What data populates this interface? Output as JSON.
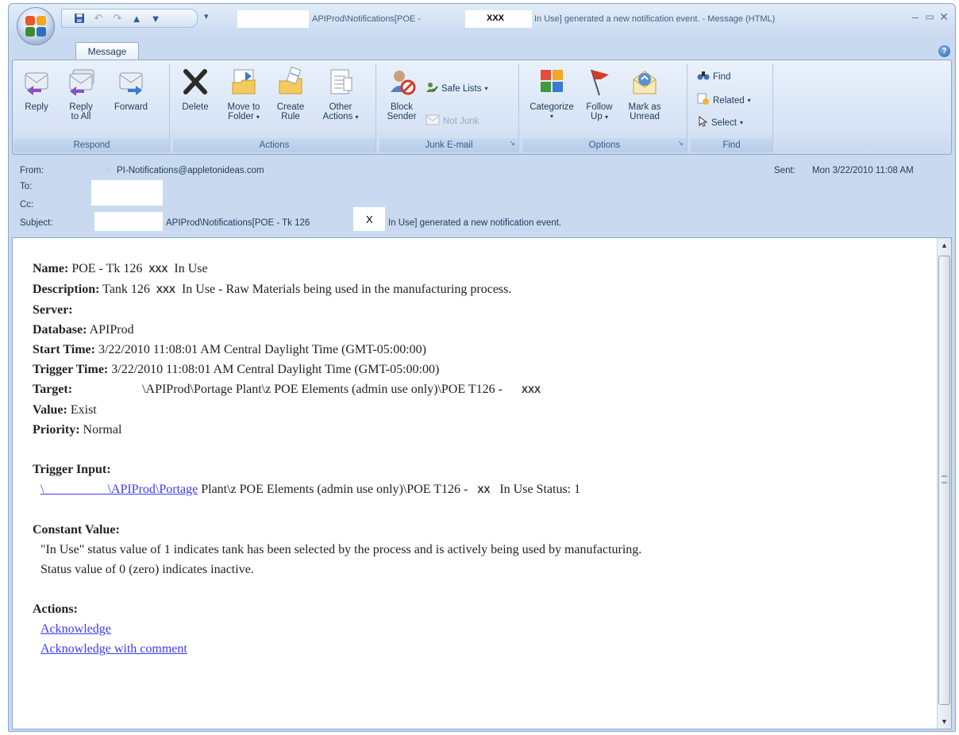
{
  "window": {
    "title_pre": "APIProd\\Notifications[POE -",
    "title_xxx": "XXX",
    "title_post": "In Use] generated a new notification event. - Message (HTML)"
  },
  "tabs": {
    "message": "Message"
  },
  "ribbon": {
    "respond": {
      "label": "Respond",
      "reply": "Reply",
      "reply_all_1": "Reply",
      "reply_all_2": "to All",
      "forward": "Forward"
    },
    "actions": {
      "label": "Actions",
      "delete": "Delete",
      "move_1": "Move to",
      "move_2": "Folder",
      "create_1": "Create",
      "create_2": "Rule",
      "other_1": "Other",
      "other_2": "Actions"
    },
    "junk": {
      "label": "Junk E-mail",
      "block_1": "Block",
      "block_2": "Sender",
      "safe_lists": "Safe Lists",
      "not_junk": "Not Junk"
    },
    "options": {
      "label": "Options",
      "categorize": "Categorize",
      "follow_1": "Follow",
      "follow_2": "Up",
      "mark_1": "Mark as",
      "mark_2": "Unread"
    },
    "find": {
      "label": "Find",
      "find": "Find",
      "related": "Related",
      "select": "Select"
    }
  },
  "header": {
    "from_label": "From:",
    "from_value": "PI-Notifications@appletonideas.com",
    "to_label": "To:",
    "cc_label": "Cc:",
    "subject_label": "Subject:",
    "subject_pre": "APIProd\\Notifications[POE - Tk 126",
    "subject_x": "X",
    "subject_post": "In Use] generated a new notification event.",
    "sent_label": "Sent:",
    "sent_value": "Mon 3/22/2010 11:08 AM"
  },
  "body": {
    "name_label": "Name:",
    "name_value": "POE - Tk 126",
    "name_xxx": "XXX",
    "name_post": "In Use",
    "desc_label": "Description:",
    "desc_value": "Tank 126",
    "desc_xxx": "XXX",
    "desc_post": "In Use - Raw Materials being used in the manufacturing process.",
    "server_label": "Server:",
    "db_label": "Database:",
    "db_value": "APIProd",
    "start_label": "Start Time:",
    "start_value": "3/22/2010 11:08:01 AM Central Daylight Time (GMT-05:00:00)",
    "trigger_label": "Trigger Time:",
    "trigger_value": "3/22/2010 11:08:01 AM Central Daylight Time (GMT-05:00:00)",
    "target_label": "Target:",
    "target_value": "\\APIProd\\Portage Plant\\z POE Elements (admin use only)\\POE T126 -",
    "target_xxx": "XXX",
    "value_label": "Value:",
    "value_value": "Exist",
    "priority_label": "Priority:",
    "priority_value": "Normal",
    "trigger_input_label": "Trigger Input:",
    "trigger_input_link": "\\                    \\APIProd\\Portage",
    "trigger_input_rest": "Plant\\z POE Elements (admin use only)\\POE T126 -",
    "trigger_input_xx": "XX",
    "trigger_input_post": "In Use Status: 1",
    "constant_label": "Constant Value:",
    "constant_line1": "\"In Use\" status value of 1 indicates tank has been selected by the process and is actively being used by manufacturing.",
    "constant_line2": "Status value of 0 (zero) indicates inactive.",
    "actions_label": "Actions:",
    "acknowledge": "Acknowledge",
    "acknowledge_comment": "Acknowledge with comment"
  }
}
